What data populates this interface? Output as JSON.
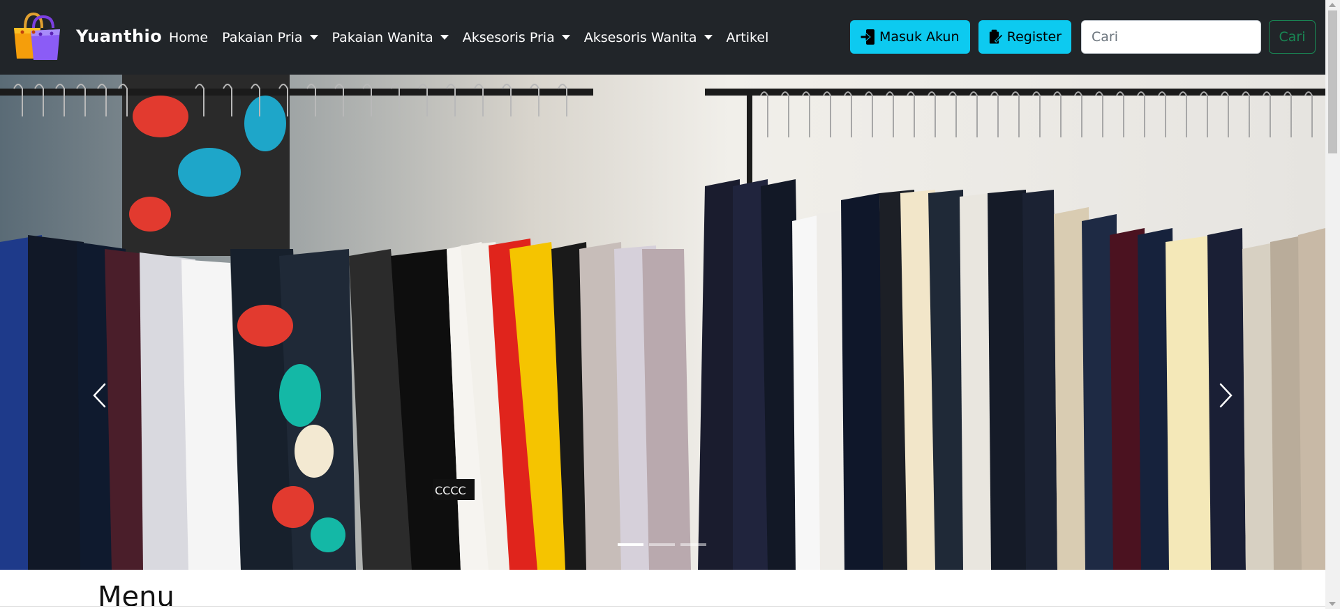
{
  "brand": {
    "name": "Yuanthio",
    "logo_icon": "shopping-bags-icon"
  },
  "nav": {
    "items": [
      {
        "label": "Home",
        "dropdown": false
      },
      {
        "label": "Pakaian Pria",
        "dropdown": true
      },
      {
        "label": "Pakaian Wanita",
        "dropdown": true
      },
      {
        "label": "Aksesoris Pria",
        "dropdown": true
      },
      {
        "label": "Aksesoris Wanita",
        "dropdown": true
      },
      {
        "label": "Artikel",
        "dropdown": false
      }
    ]
  },
  "actions": {
    "login_label": "Masuk Akun",
    "login_icon": "sign-in-icon",
    "register_label": "Register",
    "register_icon": "register-icon"
  },
  "search": {
    "placeholder": "Cari",
    "button_label": "Cari"
  },
  "carousel": {
    "slide_count": 3,
    "active_index": 0,
    "prev_icon": "chevron-left-icon",
    "next_icon": "chevron-right-icon"
  },
  "section": {
    "title": "Menu"
  },
  "colors": {
    "navbar_bg": "#212529",
    "info_button": "#0dcaf0",
    "search_button_outline": "#198754"
  }
}
